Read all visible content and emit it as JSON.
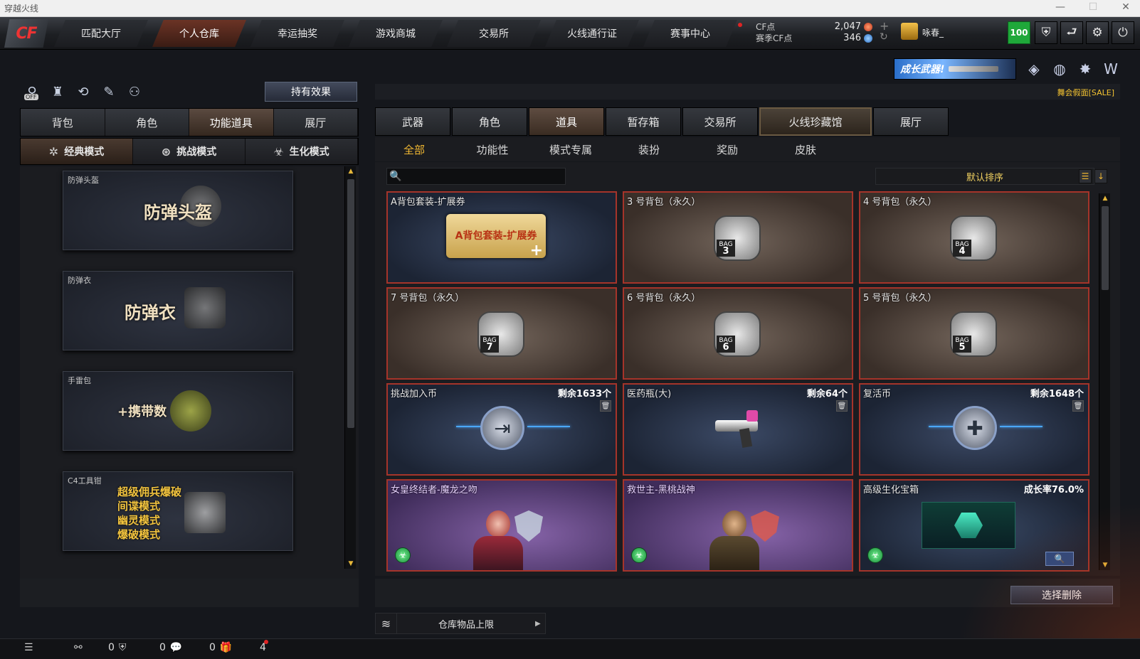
{
  "window": {
    "title": "穿越火线"
  },
  "nav": {
    "logo_text": "CF",
    "tabs": [
      "匹配大厅",
      "个人仓库",
      "幸运抽奖",
      "游戏商城",
      "交易所",
      "火线通行证",
      "赛事中心"
    ],
    "active_index": 1
  },
  "currency": {
    "cf_label": "CF点",
    "cf_value": "2,047",
    "season_label": "赛季CF点",
    "season_value": "346"
  },
  "user": {
    "name": "咏春_",
    "level": "100"
  },
  "top_icons": [
    "shield-icon",
    "return-icon",
    "gear-icon",
    "power-icon"
  ],
  "promo": {
    "growth_banner": "成长武器!",
    "sale_text": "舞会假面[SALE]",
    "badge_icons": [
      "badge-v-icon",
      "badge-globe-icon",
      "badge-wing-icon",
      "badge-w-icon"
    ]
  },
  "left": {
    "quick_icons": [
      "toggle-off-icon",
      "trophy-icon",
      "history-icon",
      "edit-icon",
      "mouse-icon"
    ],
    "off_label": "OFF",
    "hold_effect": "持有效果",
    "tabs": [
      "背包",
      "角色",
      "功能道具",
      "展厅"
    ],
    "active_tab": 2,
    "modes": [
      {
        "label": "经典模式",
        "icon": "classic-mode-icon"
      },
      {
        "label": "挑战模式",
        "icon": "challenge-mode-icon"
      },
      {
        "label": "生化模式",
        "icon": "biohazard-icon"
      }
    ],
    "equipment": [
      {
        "tag": "防弹头盔",
        "text": "防弹头盔"
      },
      {
        "tag": "防弹衣",
        "text": "防弹衣"
      },
      {
        "tag": "手雷包",
        "text": "+携带数"
      },
      {
        "tag": "C4工具钳",
        "lines": [
          "超级佣兵爆破",
          "间谍模式",
          "幽灵模式",
          "爆破模式"
        ]
      }
    ]
  },
  "right": {
    "tabs": [
      "武器",
      "角色",
      "道具",
      "暂存箱",
      "交易所",
      "火线珍藏馆",
      "展厅"
    ],
    "active_tab": 2,
    "special_tab": 5,
    "subtabs": [
      "全部",
      "功能性",
      "模式专属",
      "装扮",
      "奖励",
      "皮肤"
    ],
    "active_subtab": 0,
    "search_placeholder": "",
    "sort_label": "默认排序",
    "items": [
      {
        "name": "A背包套装-扩展券",
        "art": "A背包套装-扩展券"
      },
      {
        "name": "3 号背包（永久）",
        "bag": "3"
      },
      {
        "name": "4 号背包（永久）",
        "bag": "4"
      },
      {
        "name": "7 号背包（永久）",
        "bag": "7"
      },
      {
        "name": "6 号背包（永久）",
        "bag": "6"
      },
      {
        "name": "5 号背包（永久）",
        "bag": "5"
      },
      {
        "name": "挑战加入币",
        "qty": "剩余1633个"
      },
      {
        "name": "医药瓶(大)",
        "qty": "剩余64个"
      },
      {
        "name": "复活币",
        "qty": "剩余1648个"
      },
      {
        "name": "女皇终结者-魔龙之吻"
      },
      {
        "name": "救世主-黑桃战神"
      },
      {
        "name": "高级生化宝箱",
        "qty": "成长率76.0%"
      }
    ],
    "delete_button": "选择删除",
    "capacity_label": "仓库物品上限"
  },
  "status": {
    "counts": [
      "0",
      "0",
      "0",
      "4"
    ]
  },
  "colors": {
    "accent": "#f0b732",
    "card_border": "#a5342a",
    "level_green": "#1fa83a"
  }
}
